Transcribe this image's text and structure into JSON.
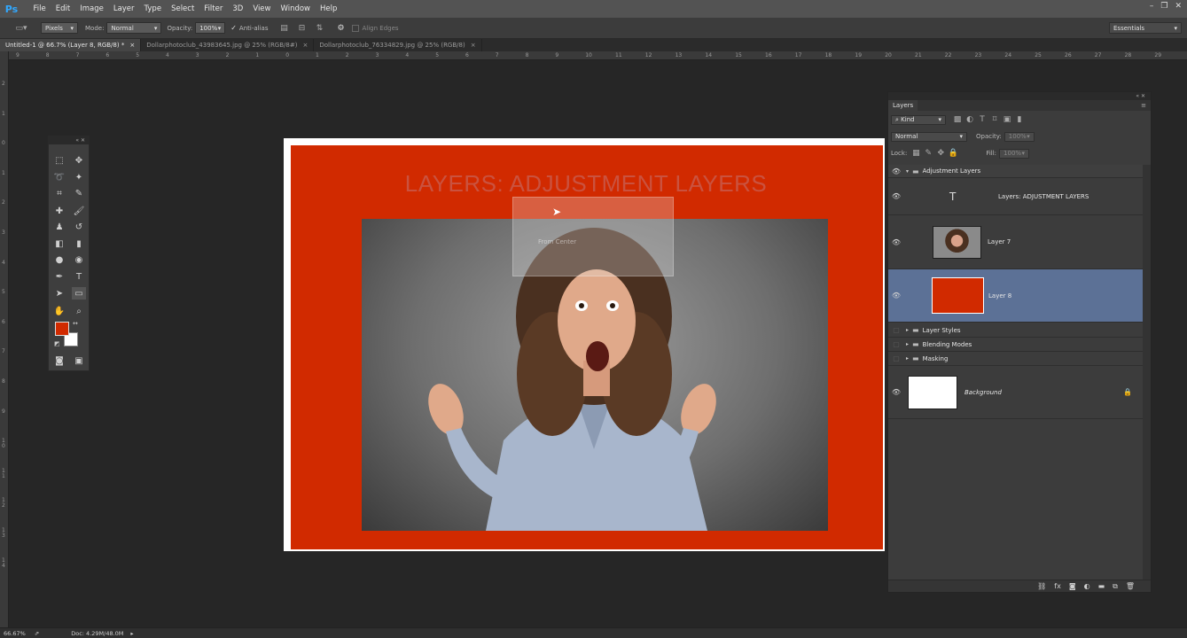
{
  "app": {
    "logo": "Ps"
  },
  "menu": [
    "File",
    "Edit",
    "Image",
    "Layer",
    "Type",
    "Select",
    "Filter",
    "3D",
    "View",
    "Window",
    "Help"
  ],
  "options": {
    "style_value": "Pixels",
    "mode_label": "Mode:",
    "mode_value": "Normal",
    "opacity_label": "Opacity:",
    "opacity_value": "100%",
    "antialias_label": "Anti-alias",
    "align_edges_label": "Align Edges",
    "workspace_value": "Essentials"
  },
  "tabs": [
    {
      "label": "Untitled-1 @ 66.7% (Layer 8, RGB/8) *",
      "close": "×"
    },
    {
      "label": "Dollarphotoclub_43983645.jpg @ 25% (RGB/8#)",
      "close": "×"
    },
    {
      "label": "Dollarphotoclub_76334829.jpg @ 25% (RGB/8)",
      "close": "×"
    }
  ],
  "ruler_h": [
    "9",
    "8",
    "7",
    "6",
    "5",
    "4",
    "3",
    "2",
    "1",
    "0",
    "1",
    "2",
    "3",
    "4",
    "5",
    "6",
    "7",
    "8",
    "9",
    "10",
    "11",
    "12",
    "13",
    "14",
    "15",
    "16",
    "17",
    "18",
    "19",
    "20",
    "21",
    "22",
    "23",
    "24",
    "25",
    "26",
    "27",
    "28",
    "29"
  ],
  "ruler_v": [
    "2",
    "1",
    "0",
    "1",
    "2",
    "3",
    "4",
    "5",
    "6",
    "7",
    "8",
    "9",
    "1 0",
    "1 1",
    "1 2",
    "1 3",
    "1 4"
  ],
  "canvas": {
    "headline": "LAYERS: ADJUSTMENT LAYERS",
    "ghost_dialog_text": "From Center"
  },
  "layers_panel": {
    "title": "Layers",
    "kind_label": "Kind",
    "blend_mode": "Normal",
    "opacity_label": "Opacity:",
    "opacity_value": "100%",
    "lock_label": "Lock:",
    "fill_label": "Fill:",
    "fill_value": "100%",
    "group_open": "Adjustment Layers",
    "text_layer": "Layers: ADJUSTMENT LAYERS",
    "layer7": "Layer 7",
    "layer8": "Layer 8",
    "group_styles": "Layer Styles",
    "group_blending": "Blending Modes",
    "group_masking": "Masking",
    "background": "Background"
  },
  "status": {
    "zoom": "66.67%",
    "doc": "Doc: 4.29M/48.0M"
  },
  "colors": {
    "foreground": "#d12a00",
    "background": "#ffffff",
    "selected_layer": "#5c7196",
    "canvas_red": "#d12a00"
  }
}
